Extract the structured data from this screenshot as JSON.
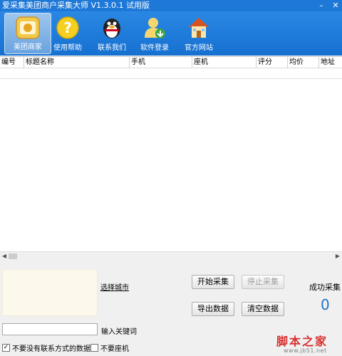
{
  "window": {
    "title": "爱采集美团商户采集大师 V1.3.0.1 试用版",
    "minimize": "–",
    "close": "✕"
  },
  "toolbar": {
    "items": [
      {
        "label": "美团商家",
        "icon": "meituan-icon",
        "active": true
      },
      {
        "label": "使用帮助",
        "icon": "help-icon",
        "active": false
      },
      {
        "label": "联系我们",
        "icon": "qq-penguin-icon",
        "active": false
      },
      {
        "label": "软件登录",
        "icon": "user-login-icon",
        "active": false
      },
      {
        "label": "官方网站",
        "icon": "home-icon",
        "active": false
      }
    ]
  },
  "grid": {
    "columns": [
      "编号",
      "标题名称",
      "手机",
      "座机",
      "评分",
      "均价",
      "地址"
    ]
  },
  "panel": {
    "select_city": "选择城市",
    "start_button": "开始采集",
    "stop_button": "停止采集",
    "export_button": "导出数据",
    "clear_button": "清空数据",
    "keyword_label": "输入关键词",
    "keyword_value": "",
    "success_label": "成功采集",
    "success_count": "0",
    "opt_no_contact": "不要没有联系方式的数据",
    "opt_no_landline": "不要座机"
  },
  "watermark": {
    "main": "脚本之家",
    "sub": "www.jb51.net"
  },
  "colors": {
    "titlebar": "#1e78d8",
    "toolbar": "#1670d0",
    "accent_count": "#1e74c8"
  }
}
